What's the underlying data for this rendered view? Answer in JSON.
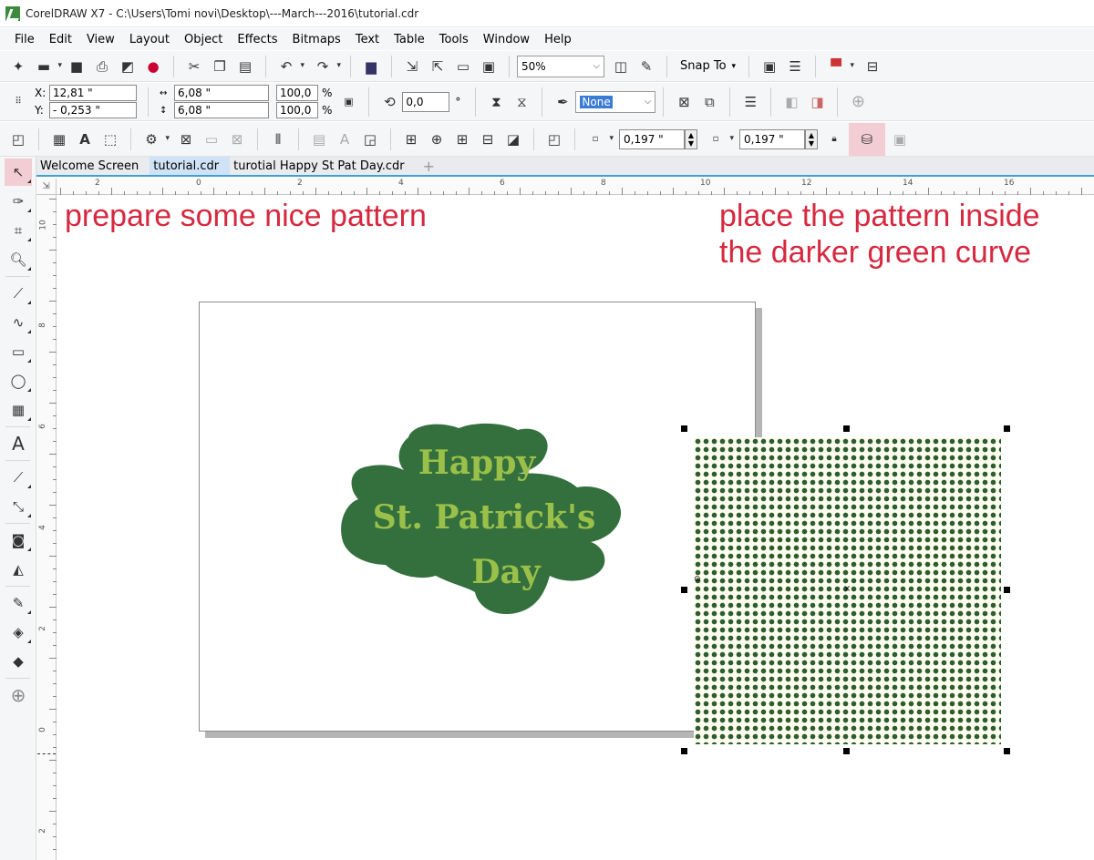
{
  "window": {
    "title": "CorelDRAW X7 - C:\\Users\\Tomi novi\\Desktop\\---March---2016\\tutorial.cdr"
  },
  "menu": [
    "File",
    "Edit",
    "View",
    "Layout",
    "Object",
    "Effects",
    "Bitmaps",
    "Text",
    "Table",
    "Tools",
    "Window",
    "Help"
  ],
  "standard_toolbar": {
    "zoom": "50%",
    "snap_to": "Snap To"
  },
  "property_bar": {
    "x_label": "X:",
    "x_value": "12,81 \"",
    "y_label": "Y:",
    "y_value": "- 0,253 \"",
    "width_value": "6,08 \"",
    "height_value": "6,08 \"",
    "scale_x": "100,0",
    "scale_y": "100,0",
    "pct": "%",
    "rotation": "0,0",
    "degree": "°",
    "outline": "None"
  },
  "object_bar": {
    "offset_x": "0,197 \"",
    "offset_y": "0,197 \""
  },
  "tabs": [
    "Welcome Screen",
    "tutorial.cdr",
    "turotial Happy St Pat Day.cdr"
  ],
  "ruler_h_labels": [
    "2",
    "0",
    "2",
    "4",
    "6",
    "8",
    "10",
    "12",
    "14",
    "16"
  ],
  "ruler_v_labels": [
    "10",
    "8",
    "6",
    "4",
    "2",
    "0",
    "2"
  ],
  "annotations": {
    "left": "prepare some nice pattern",
    "right_line1": "place the pattern inside",
    "right_line2": "the darker green curve"
  },
  "artwork": {
    "line1": "Happy",
    "line2": "St. Patrick's",
    "line3": "Day"
  },
  "colors": {
    "dark_green": "#34703d",
    "light_green": "#9bc04a",
    "annotation_red": "#d6283f",
    "tab_accent": "#3fa0d8"
  }
}
